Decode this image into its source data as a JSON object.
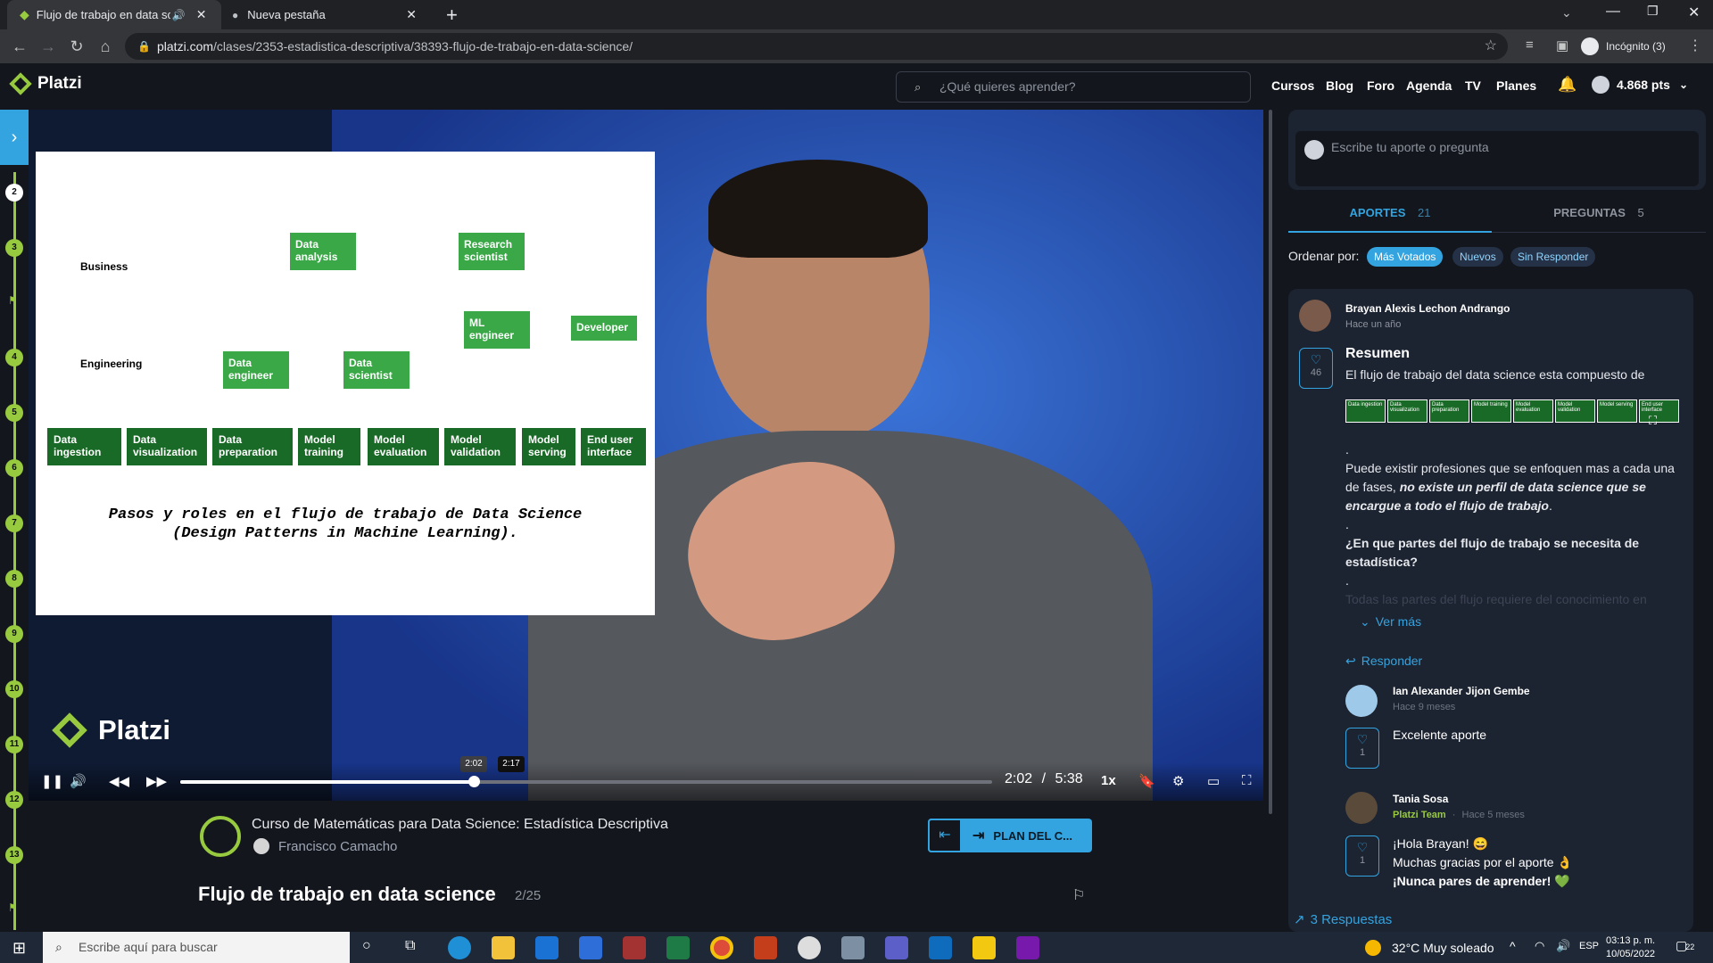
{
  "browser": {
    "tabs": [
      {
        "title": "Flujo de trabajo en data scie"
      },
      {
        "title": "Nueva pestaña"
      }
    ],
    "url_domain": "platzi.com",
    "url_path": "/clases/2353-estadistica-descriptiva/38393-flujo-de-trabajo-en-data-science/",
    "profile": "Incógnito (3)"
  },
  "header": {
    "logo": "Platzi",
    "search_placeholder": "¿Qué quieres aprender?",
    "nav": [
      "Cursos",
      "Blog",
      "Foro",
      "Agenda",
      "TV",
      "Planes"
    ],
    "points": "4.868 pts"
  },
  "rail": {
    "steps": [
      "2",
      "3",
      "4",
      "5",
      "6",
      "7",
      "8",
      "9",
      "10",
      "11",
      "12",
      "13"
    ]
  },
  "slide": {
    "row_labels": [
      "Business",
      "Engineering"
    ],
    "roles": [
      {
        "label": "Data analysis"
      },
      {
        "label": "Research scientist"
      },
      {
        "label": "ML engineer"
      },
      {
        "label": "Developer"
      },
      {
        "label": "Data engineer"
      },
      {
        "label": "Data scientist"
      }
    ],
    "steps": [
      "Data ingestion",
      "Data visualization",
      "Data preparation",
      "Model training",
      "Model evaluation",
      "Model validation",
      "Model serving",
      "End user interface"
    ],
    "caption_line1": "Pasos y roles en el flujo de trabajo de Data Science",
    "caption_line2": "(Design Patterns in Machine Learning).",
    "watermark": "Platzi"
  },
  "player": {
    "tooltip_current": "2:02",
    "tooltip_hover": "2:17",
    "current_time": "2:02",
    "separator": "/",
    "duration": "5:38",
    "speed": "1x",
    "progress": 0.361
  },
  "course": {
    "title": "Curso de Matemáticas para Data Science: Estadística Descriptiva",
    "teacher": "Francisco Camacho",
    "plan_button": "PLAN DEL C...",
    "class_title": "Flujo de trabajo en data science",
    "class_index": "2/25"
  },
  "comments": {
    "input_placeholder": "Escribe tu aporte o pregunta",
    "tabs": [
      {
        "label": "APORTES",
        "count": "21"
      },
      {
        "label": "PREGUNTAS",
        "count": "5"
      }
    ],
    "sort_label": "Ordenar por:",
    "sort_options": [
      "Más Votados",
      "Nuevos",
      "Sin Responder"
    ],
    "main": {
      "author": "Brayan Alexis Lechon Andrango",
      "time": "Hace un año",
      "likes": "46",
      "title": "Resumen",
      "intro": "El flujo de trabajo del data science esta compuesto de",
      "mini_steps": [
        "Data ingestion",
        "Data visualization",
        "Data preparation",
        "Model training",
        "Model evaluation",
        "Model validation",
        "Model serving",
        "End user interface"
      ],
      "dot1": ".",
      "p1_normal": "Puede existir profesiones que se enfoquen mas a cada una de fases, ",
      "p1_emph": "no existe un perfil de data science que se encargue a todo el flujo de trabajo",
      "p1_end": ".",
      "dot2": ".",
      "question": "¿En que partes del flujo de trabajo se necesita de estadística?",
      "dot3": ".",
      "faded": "Todas las partes del flujo requiere del conocimiento en",
      "see_more": "Ver más",
      "reply": "Responder"
    },
    "replies": [
      {
        "author": "Ian Alexander Jijon Gembe",
        "badge": "",
        "time": "Hace 9 meses",
        "likes": "1",
        "lines": [
          "Excelente aporte"
        ]
      },
      {
        "author": "Tania Sosa",
        "badge": "Platzi Team",
        "time": "Hace 5 meses",
        "likes": "1",
        "lines": [
          "¡Hola Brayan! 😄",
          "Muchas gracias por el aporte 👌",
          "¡Nunca pares de aprender! 💚"
        ]
      }
    ],
    "replies_link": "3 Respuestas"
  },
  "taskbar": {
    "search_placeholder": "Escribe aquí para buscar",
    "weather": "32°C  Muy soleado",
    "lang": "ESP",
    "time": "03:13 p. m.",
    "date": "10/05/2022",
    "notifications": "22"
  },
  "colors": {
    "platzi_green": "#98ca3f",
    "accent_blue": "#33a4e0",
    "bg": "#13161c"
  }
}
